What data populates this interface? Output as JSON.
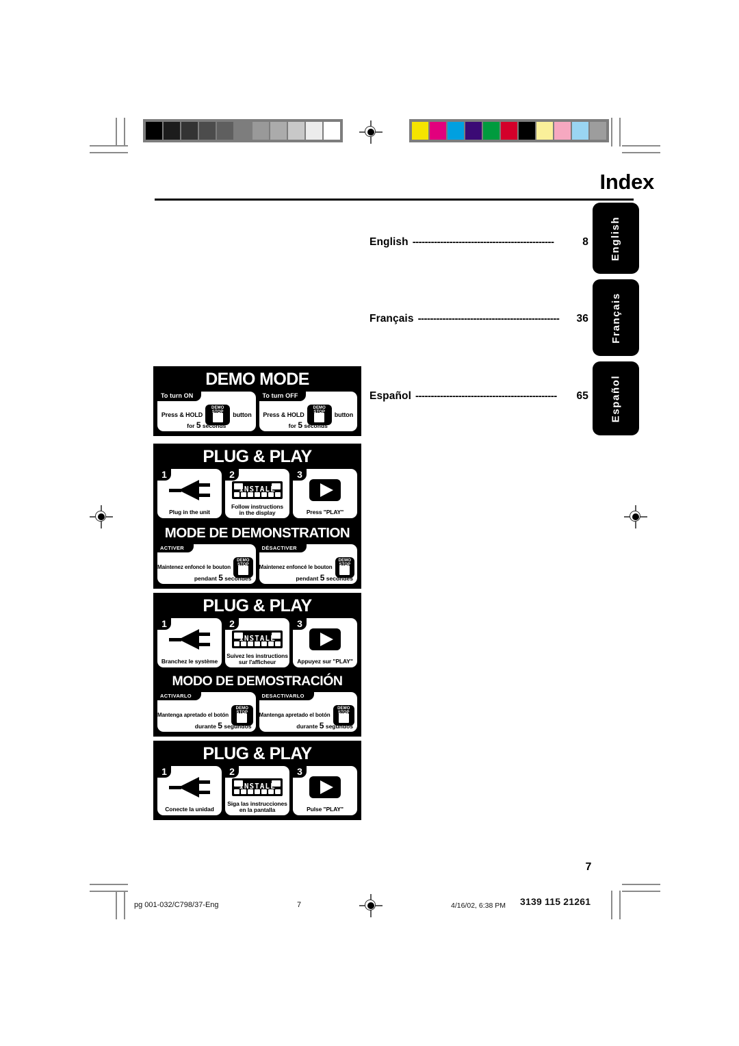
{
  "header": {
    "title": "Index"
  },
  "toc": {
    "dots": "----------------------------------------------",
    "entries": [
      {
        "label": "English",
        "page": "8"
      },
      {
        "label": "Français",
        "page": "36"
      },
      {
        "label": "Español",
        "page": "65"
      }
    ]
  },
  "side_tabs": [
    {
      "label": "English"
    },
    {
      "label": "Français"
    },
    {
      "label": "Español"
    }
  ],
  "panels": [
    {
      "id": "demo-mode-en",
      "kind": "demo",
      "title": "DEMO MODE",
      "cards": [
        {
          "head": "To turn ON",
          "press": "Press & HOLD",
          "button_label": "DEMO STOP",
          "suffix": "button",
          "foot_pre": "for ",
          "foot_num": "5",
          "foot_post": " seconds"
        },
        {
          "head": "To turn OFF",
          "press": "Press & HOLD",
          "button_label": "DEMO STOP",
          "suffix": "button",
          "foot_pre": "for ",
          "foot_num": "5",
          "foot_post": " seconds"
        }
      ]
    },
    {
      "id": "plug-play-en",
      "kind": "plugplay",
      "title": "PLUG & PLAY",
      "steps": [
        {
          "num": "1",
          "icon": "power-plug-icon",
          "caption": "Plug in the unit"
        },
        {
          "num": "2",
          "icon": "lcd-display-icon",
          "caption": "Follow instructions\nin the display",
          "display_text": "INSTALL"
        },
        {
          "num": "3",
          "icon": "play-button-icon",
          "caption": "Press \"PLAY\""
        }
      ]
    },
    {
      "id": "demo-mode-fr",
      "kind": "demo",
      "title": "MODE DE DEMONSTRATION",
      "cards": [
        {
          "head": "ACTIVER",
          "press": "Maintenez enfoncé le bouton",
          "button_label": "DEMO STOP",
          "suffix": "",
          "foot_pre": "pendant ",
          "foot_num": "5",
          "foot_post": " secondes"
        },
        {
          "head": "DÉSACTIVER",
          "press": "Maintenez enfoncé le bouton",
          "button_label": "DEMO STOP",
          "suffix": "",
          "foot_pre": "pendant ",
          "foot_num": "5",
          "foot_post": " secondes"
        }
      ]
    },
    {
      "id": "plug-play-fr",
      "kind": "plugplay",
      "title": "PLUG & PLAY",
      "steps": [
        {
          "num": "1",
          "icon": "power-plug-icon",
          "caption": "Branchez le système"
        },
        {
          "num": "2",
          "icon": "lcd-display-icon",
          "caption": "Suivez les instructions\nsur l'afficheur",
          "display_text": "INSTALL"
        },
        {
          "num": "3",
          "icon": "play-button-icon",
          "caption": "Appuyez sur \"PLAY\""
        }
      ]
    },
    {
      "id": "demo-mode-es",
      "kind": "demo",
      "title": "MODO DE DEMOSTRACIÓN",
      "cards": [
        {
          "head": "ACTIVARLO",
          "press": "Mantenga apretado el botón",
          "button_label": "DEMO STOP",
          "suffix": "",
          "foot_pre": "durante ",
          "foot_num": "5",
          "foot_post": " segundos"
        },
        {
          "head": "DESACTIVARLO",
          "press": "Mantenga apretado el botón",
          "button_label": "DEMO STOP",
          "suffix": "",
          "foot_pre": "durante ",
          "foot_num": "5",
          "foot_post": " segundos"
        }
      ]
    },
    {
      "id": "plug-play-es",
      "kind": "plugplay",
      "title": "PLUG & PLAY",
      "steps": [
        {
          "num": "1",
          "icon": "power-plug-icon",
          "caption": "Conecte la unidad"
        },
        {
          "num": "2",
          "icon": "lcd-display-icon",
          "caption": "Siga las instrucciones\nen la pantalla",
          "display_text": "INSTALL"
        },
        {
          "num": "3",
          "icon": "play-button-icon",
          "caption": "Pulse \"PLAY\""
        }
      ]
    }
  ],
  "folio": "7",
  "footer": {
    "file": "pg 001-032/C798/37-Eng",
    "page": "7",
    "date": "4/16/02, 6:38 PM",
    "code": "3139 115 21261"
  },
  "print_marks": {
    "greyscale_bar": [
      "#000000",
      "#1c1c1c",
      "#333333",
      "#4c4c4c",
      "#5f5f5f",
      "#7d7d7d",
      "#999999",
      "#ababab",
      "#c8c8c8",
      "#ececec",
      "#ffffff"
    ],
    "colour_bar": [
      "#f5e400",
      "#e2007d",
      "#00a0e0",
      "#3b0a75",
      "#009b3e",
      "#d4002a",
      "#000000",
      "#faf09a",
      "#f6a8c0",
      "#9ad5f2",
      "#9d9d9d"
    ]
  }
}
